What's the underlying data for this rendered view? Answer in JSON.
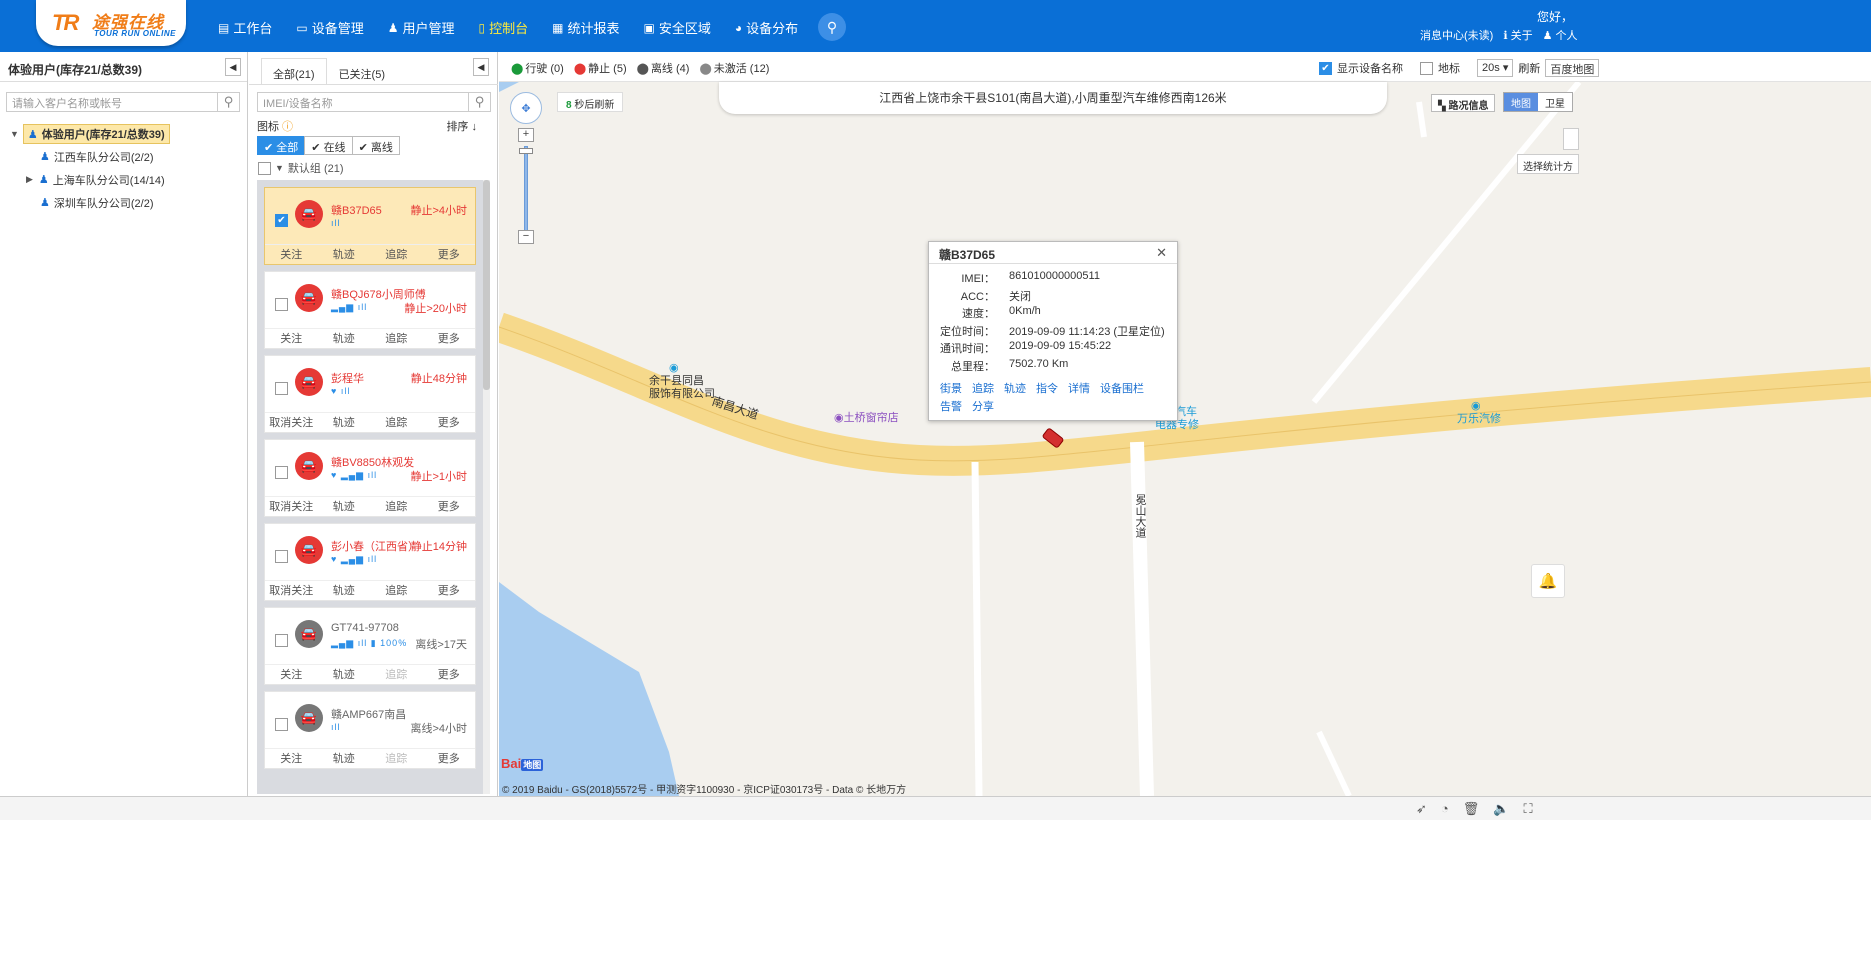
{
  "header": {
    "logo_mark": "TR",
    "logo_text": "途强在线",
    "logo_sub": "TOUR RUN ONLINE",
    "nav": [
      {
        "icon": "▤",
        "label": "工作台",
        "active": false
      },
      {
        "icon": "▭",
        "label": "设备管理",
        "active": false
      },
      {
        "icon": "♟",
        "label": "用户管理",
        "active": false
      },
      {
        "icon": "▯",
        "label": "控制台",
        "active": true
      },
      {
        "icon": "▦",
        "label": "统计报表",
        "active": false
      },
      {
        "icon": "▣",
        "label": "安全区域",
        "active": false
      },
      {
        "icon": "◕",
        "label": "设备分布",
        "active": false
      }
    ],
    "greeting": "您好，",
    "message_center": "消息中心(未读)",
    "about": "关于",
    "personal": "个人"
  },
  "left_panel": {
    "title": "体验用户(库存21/总数39)",
    "search_placeholder": "请输入客户名称或帐号",
    "tree": {
      "root": "体验用户(库存21/总数39)",
      "children": [
        {
          "label": "江西车队分公司(2/2)",
          "expandable": false
        },
        {
          "label": "上海车队分公司(14/14)",
          "expandable": true
        },
        {
          "label": "深圳车队分公司(2/2)",
          "expandable": false
        }
      ]
    }
  },
  "device_panel": {
    "tabs": [
      "全部(21)",
      "已关注(5)"
    ],
    "search_placeholder": "IMEI/设备名称",
    "icon_label": "图标",
    "sort_label": "排序",
    "filters": [
      "全部",
      "在线",
      "离线"
    ],
    "group_label": "默认组 (21)",
    "devices": [
      {
        "name": "赣B37D65",
        "status": "静止>4小时",
        "signal": "ıll",
        "follow": "关注",
        "selected": true,
        "gray": false,
        "tracking_disabled": false
      },
      {
        "name": "赣BQJ678小周师傅",
        "status": "静止>20小时",
        "signal": "▂▄▆ ıll",
        "follow": "关注",
        "selected": false,
        "gray": false,
        "tracking_disabled": false
      },
      {
        "name": "彭程华",
        "status": "静止48分钟",
        "signal": "♥ ıll",
        "follow": "取消关注",
        "selected": false,
        "gray": false,
        "tracking_disabled": false
      },
      {
        "name": "赣BV8850林观发",
        "status": "静止>1小时",
        "signal": "♥ ▂▄▆ ıll",
        "follow": "取消关注",
        "selected": false,
        "gray": false,
        "tracking_disabled": false
      },
      {
        "name": "彭小春（江西省）",
        "status": "静止14分钟",
        "signal": "♥ ▂▄▆ ıll",
        "follow": "取消关注",
        "selected": false,
        "gray": false,
        "tracking_disabled": false
      },
      {
        "name": "GT741-97708",
        "status": "离线>17天",
        "signal": "▂▄▆ ıll ▮ 100%",
        "follow": "关注",
        "selected": false,
        "gray": true,
        "tracking_disabled": true
      },
      {
        "name": "赣AMP667南昌",
        "status": "离线>4小时",
        "signal": "ıll",
        "follow": "关注",
        "selected": false,
        "gray": true,
        "tracking_disabled": true
      }
    ],
    "actions": [
      "轨迹",
      "追踪",
      "更多"
    ]
  },
  "map": {
    "legend": [
      {
        "label": "行驶 (0)",
        "color": "#1a9a3a"
      },
      {
        "label": "静止 (5)",
        "color": "#e53935"
      },
      {
        "label": "离线 (4)",
        "color": "#555555"
      },
      {
        "label": "未激活 (12)",
        "color": "#888888"
      }
    ],
    "show_device_name": "显示设备名称",
    "landmark": "地标",
    "interval": "20s",
    "refresh": "刷新",
    "map_provider": "百度地图",
    "address": "江西省上饶市余干县S101(南昌大道),小周重型汽车维修西南126米",
    "countdown": "8",
    "countdown_suffix": "秒后刷新",
    "road_info": "路况信息",
    "map_types": [
      "地图",
      "卫星"
    ],
    "stats_select": "选择统计方",
    "popup": {
      "title": "赣B37D65",
      "rows": [
        {
          "key": "IMEI：",
          "value": "861010000000511"
        },
        {
          "key": "ACC：",
          "value": "关闭"
        },
        {
          "key": "速度：",
          "value": "0Km/h"
        },
        {
          "key": "定位时间：",
          "value": "2019-09-09 11:14:23 (卫星定位)"
        },
        {
          "key": "通讯时间：",
          "value": "2019-09-09 15:45:22"
        },
        {
          "key": "总里程：",
          "value": "7502.70 Km"
        }
      ],
      "links1": [
        "街景",
        "追踪",
        "轨迹",
        "指令",
        "详情",
        "设备围栏"
      ],
      "links2": [
        "告警",
        "分享"
      ]
    },
    "poi": [
      "余干县同昌",
      "服饰有限公司",
      "南昌大道",
      "土桥窗帘店",
      "汽车",
      "电器专修",
      "万乐汽修",
      "冕山大道"
    ],
    "baidu_logo": "Bai",
    "baidu_logo_tag": "地图",
    "copyright": "© 2019 Baidu - GS(2018)5572号 - 甲测资字1100930 - 京ICP证030173号 - Data © 长地万方"
  }
}
